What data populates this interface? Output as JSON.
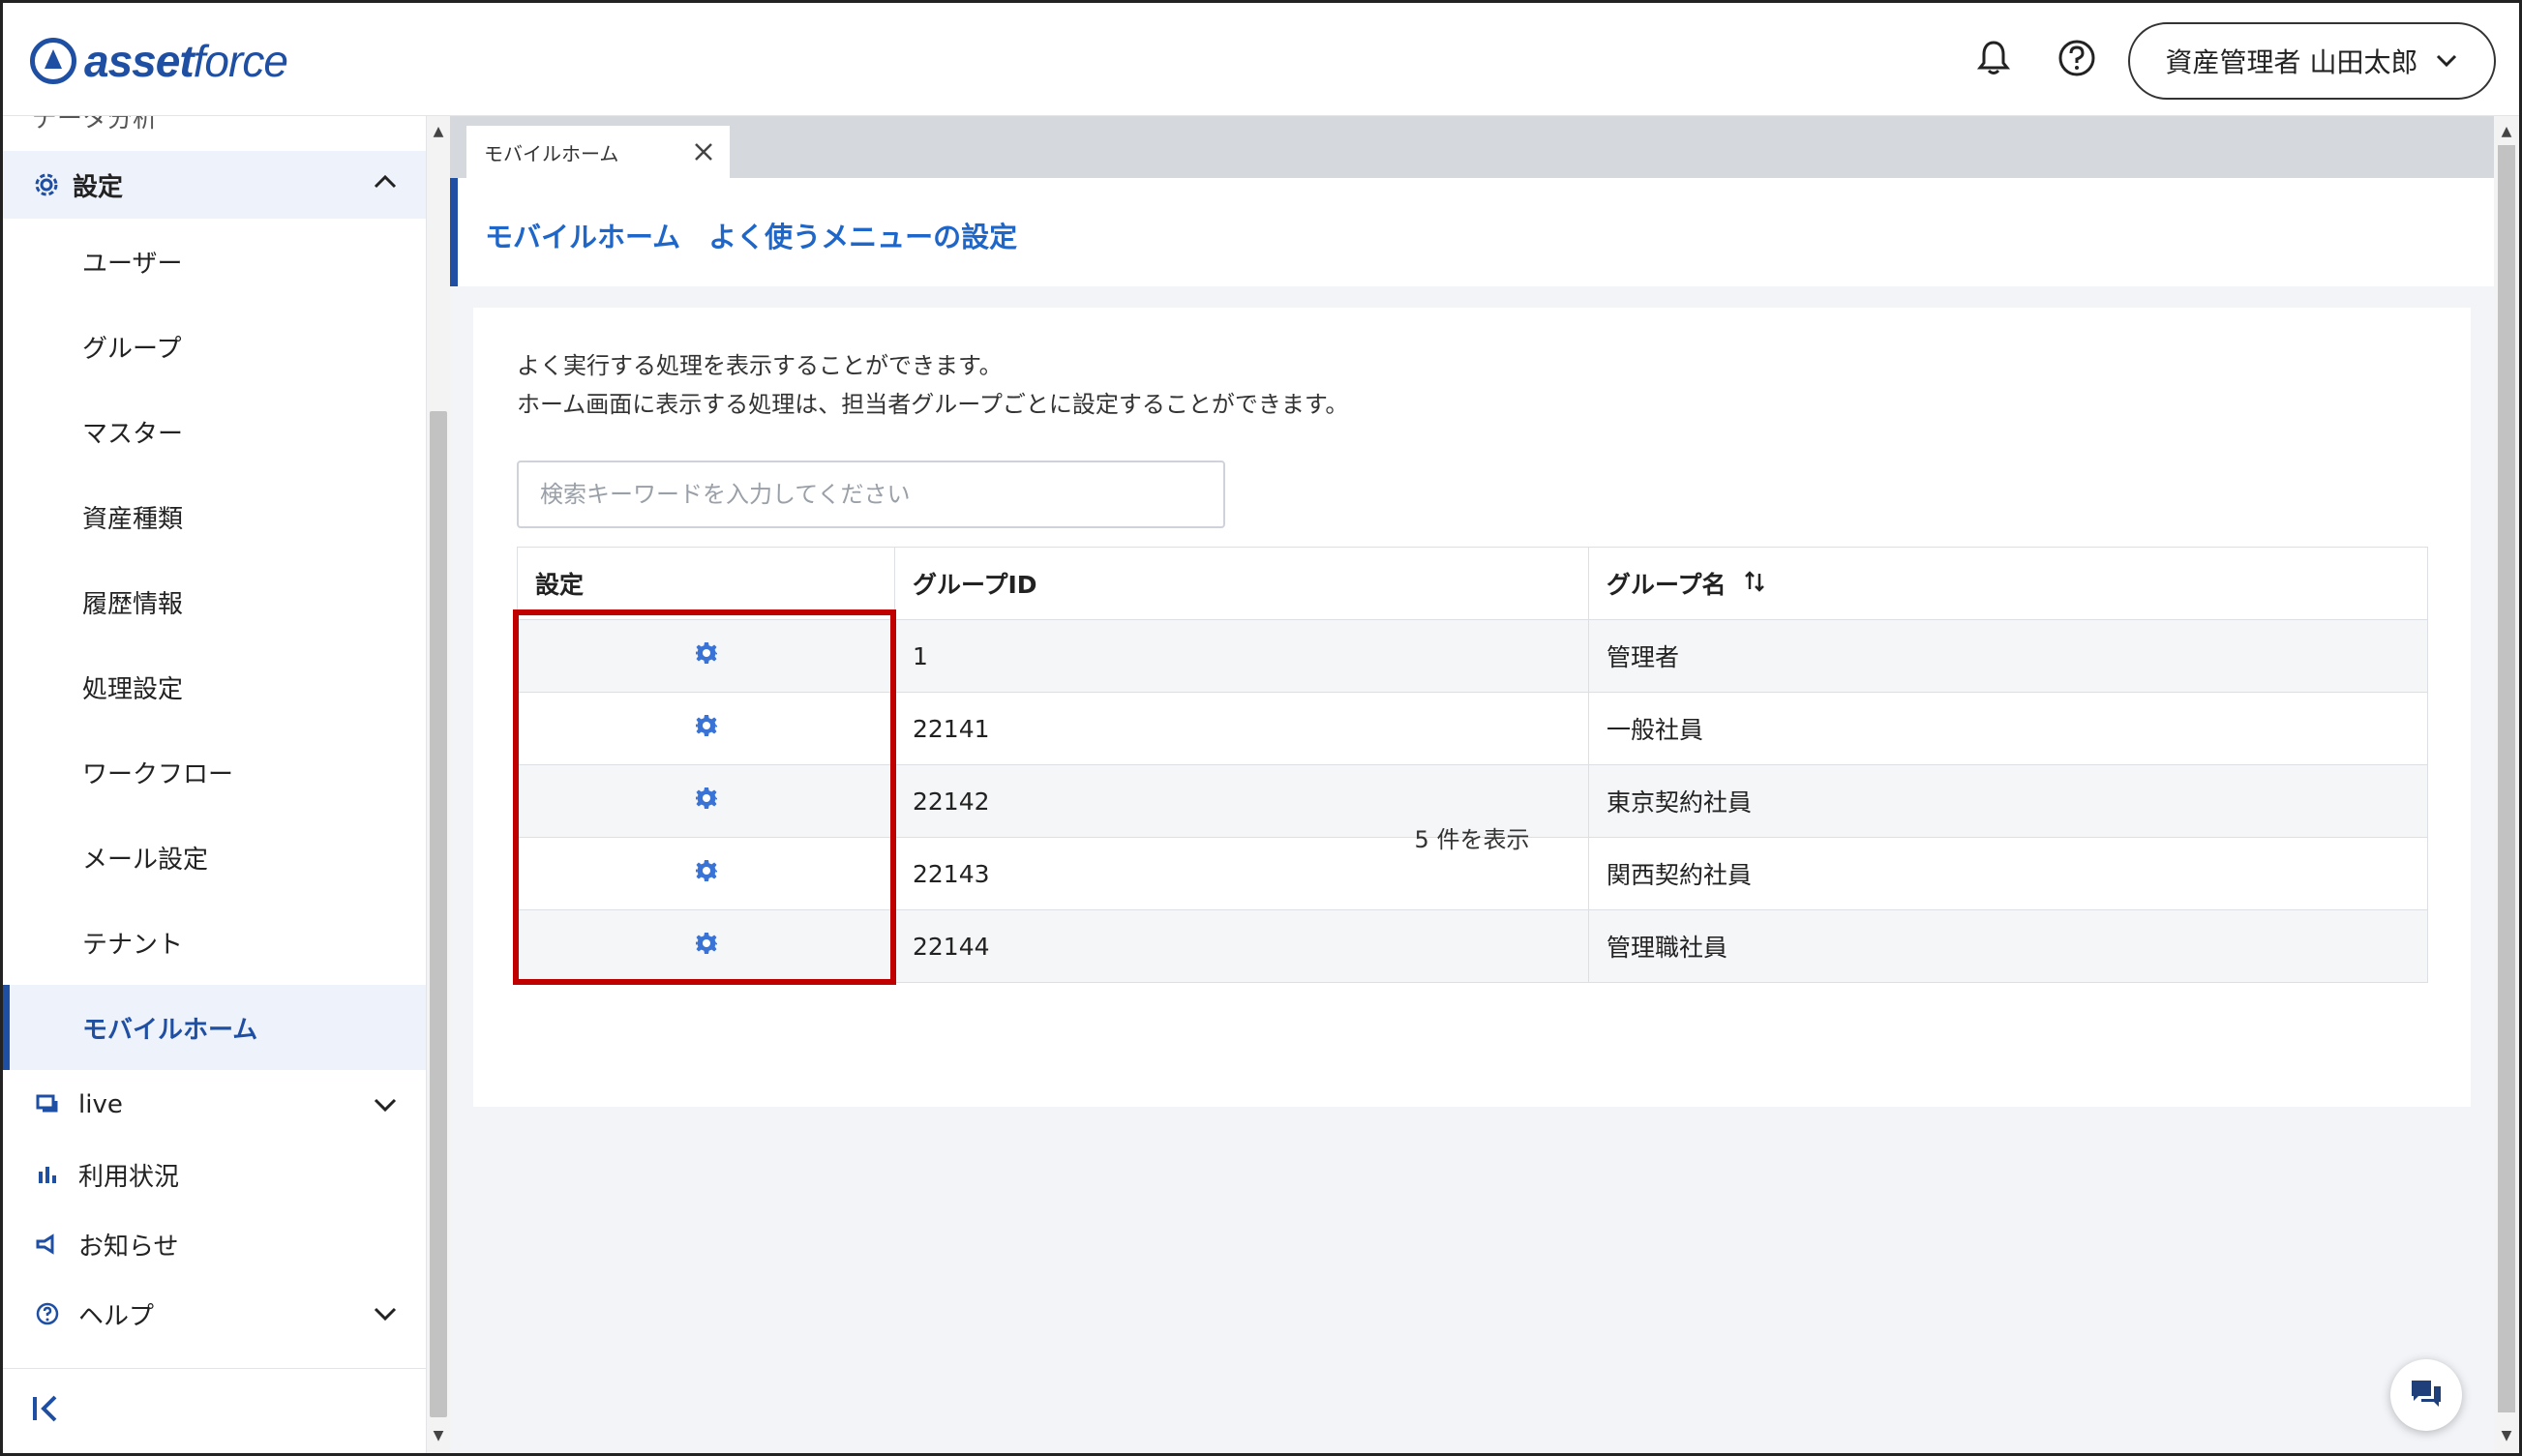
{
  "header": {
    "logo_bold": "asset",
    "logo_light": "force",
    "user_label": "資産管理者 山田太郎"
  },
  "sidebar": {
    "cut_item": "データ分析",
    "section_label": "設定",
    "sub_items": [
      "ユーザー",
      "グループ",
      "マスター",
      "資産種類",
      "履歴情報",
      "処理設定",
      "ワークフロー",
      "メール設定",
      "テナント",
      "モバイルホーム"
    ],
    "active_item": "モバイルホーム",
    "main_items": [
      "live",
      "利用状況",
      "お知らせ",
      "ヘルプ"
    ]
  },
  "tabs": [
    {
      "label": "モバイルホーム"
    }
  ],
  "page": {
    "title": "モバイルホーム　よく使うメニューの設定",
    "desc_line1": "よく実行する処理を表示することができます。",
    "desc_line2": "ホーム画面に表示する処理は、担当者グループごとに設定することができます。",
    "search_placeholder": "検索キーワードを入力してください"
  },
  "table": {
    "headers": [
      "設定",
      "グループID",
      "グループ名"
    ],
    "sort_icon": "sort-icon",
    "rows": [
      {
        "id": "1",
        "name": "管理者"
      },
      {
        "id": "22141",
        "name": "一般社員"
      },
      {
        "id": "22142",
        "name": "東京契約社員"
      },
      {
        "id": "22143",
        "name": "関西契約社員"
      },
      {
        "id": "22144",
        "name": "管理職社員"
      }
    ]
  },
  "footer": {
    "count_text": "5 件を表示"
  },
  "colors": {
    "brand": "#1f4fa3",
    "link": "#1f66c9",
    "highlight": "#c00000"
  }
}
